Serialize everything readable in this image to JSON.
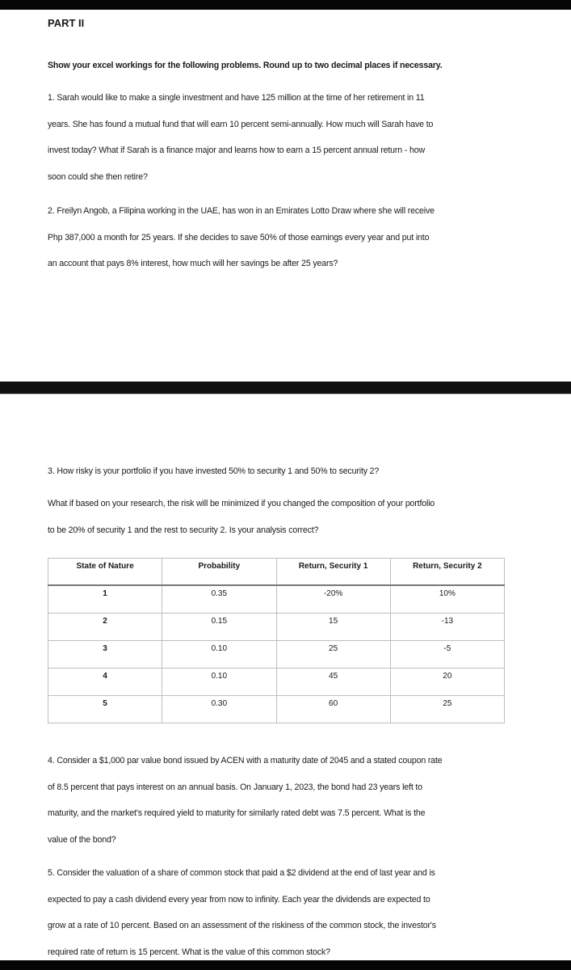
{
  "title": "PART II",
  "instructions": "Show your excel workings for the following problems. Round up to two decimal places if necessary.",
  "q1": [
    "1. Sarah would like to make a single investment and have 125 million at the time of her retirement in 11",
    "years. She has found a mutual fund that will earn 10 percent semi-annually. How much will Sarah have to",
    "invest today? What if Sarah is a finance major and learns how to earn a 15 percent annual return - how",
    "soon could she then retire?"
  ],
  "q2": [
    "2. Freilyn Angob, a Filipina working in the UAE, has won in an Emirates Lotto Draw where she will receive",
    "Php 387,000 a month for 25 years.  If she decides to save 50% of those earnings every year and put into",
    "an account that pays 8% interest, how much will her savings be after 25 years?"
  ],
  "q3": [
    "3. How risky is your portfolio if you have invested 50% to security 1 and 50% to security 2?",
    "What if based on your research, the risk will be minimized if you changed the composition of your portfolio",
    "to be 20% of security 1 and the rest to security 2. Is your analysis correct?"
  ],
  "table": {
    "headers": [
      "State of Nature",
      "Probability",
      "Return, Security 1",
      "Return, Security 2"
    ],
    "rows": [
      [
        "1",
        "0.35",
        "-20%",
        "10%"
      ],
      [
        "2",
        "0.15",
        "15",
        "-13"
      ],
      [
        "3",
        "0.10",
        "25",
        "-5"
      ],
      [
        "4",
        "0.10",
        "45",
        "20"
      ],
      [
        "5",
        "0.30",
        "60",
        "25"
      ]
    ]
  },
  "q4": [
    "4. Consider a $1,000 par value bond issued by ACEN with a maturity date of 2045 and a stated coupon rate",
    "of 8.5 percent that pays interest on an annual basis. On January 1, 2023, the bond had 23 years left to",
    "maturity, and the market's required yield to maturity for similarly rated debt was 7.5 percent. What is the",
    "value of the bond?"
  ],
  "q5": [
    "5. Consider the valuation of a share of common stock that paid a $2 dividend at the end of last year and is",
    "expected to pay a cash dividend every year from now to infinity. Each year the dividends are expected to",
    "grow at a rate of 10 percent. Based on an assessment of the riskiness of the common stock, the investor's",
    "required rate of return is 15 percent.  What is the value of this common stock?"
  ]
}
